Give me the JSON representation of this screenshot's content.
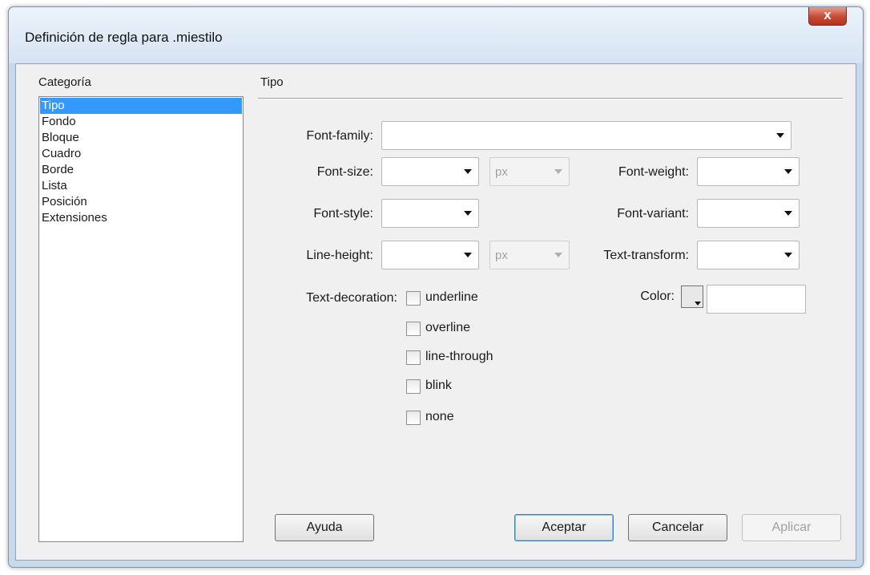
{
  "window": {
    "title": "Definición de regla para .miestilo",
    "close_label": "x"
  },
  "categories": {
    "label": "Categoría",
    "items": [
      "Tipo",
      "Fondo",
      "Bloque",
      "Cuadro",
      "Borde",
      "Lista",
      "Posición",
      "Extensiones"
    ],
    "selected": "Tipo"
  },
  "section": {
    "title": "Tipo"
  },
  "fields": {
    "font_family": {
      "label": "Font-family:",
      "value": ""
    },
    "font_size": {
      "label": "Font-size:",
      "value": "",
      "unit": "px"
    },
    "font_weight": {
      "label": "Font-weight:",
      "value": ""
    },
    "font_style": {
      "label": "Font-style:",
      "value": ""
    },
    "font_variant": {
      "label": "Font-variant:",
      "value": ""
    },
    "line_height": {
      "label": "Line-height:",
      "value": "",
      "unit": "px"
    },
    "text_transform": {
      "label": "Text-transform:",
      "value": ""
    },
    "color": {
      "label": "Color:",
      "value": ""
    }
  },
  "text_decoration": {
    "label": "Text-decoration:",
    "options": [
      {
        "label": "underline",
        "checked": false
      },
      {
        "label": "overline",
        "checked": false
      },
      {
        "label": "line-through",
        "checked": false
      },
      {
        "label": "blink",
        "checked": false
      },
      {
        "label": "none",
        "checked": false
      }
    ]
  },
  "buttons": {
    "help": "Ayuda",
    "ok": "Aceptar",
    "cancel": "Cancelar",
    "apply": "Aplicar"
  },
  "colors": {
    "selection": "#3399ff",
    "title_bar": "#d6e3f2",
    "close_button": "#c64a33"
  },
  "icons": {
    "close": "close-icon",
    "dropdown": "chevron-down-icon",
    "color_picker": "color-swatch-icon"
  }
}
